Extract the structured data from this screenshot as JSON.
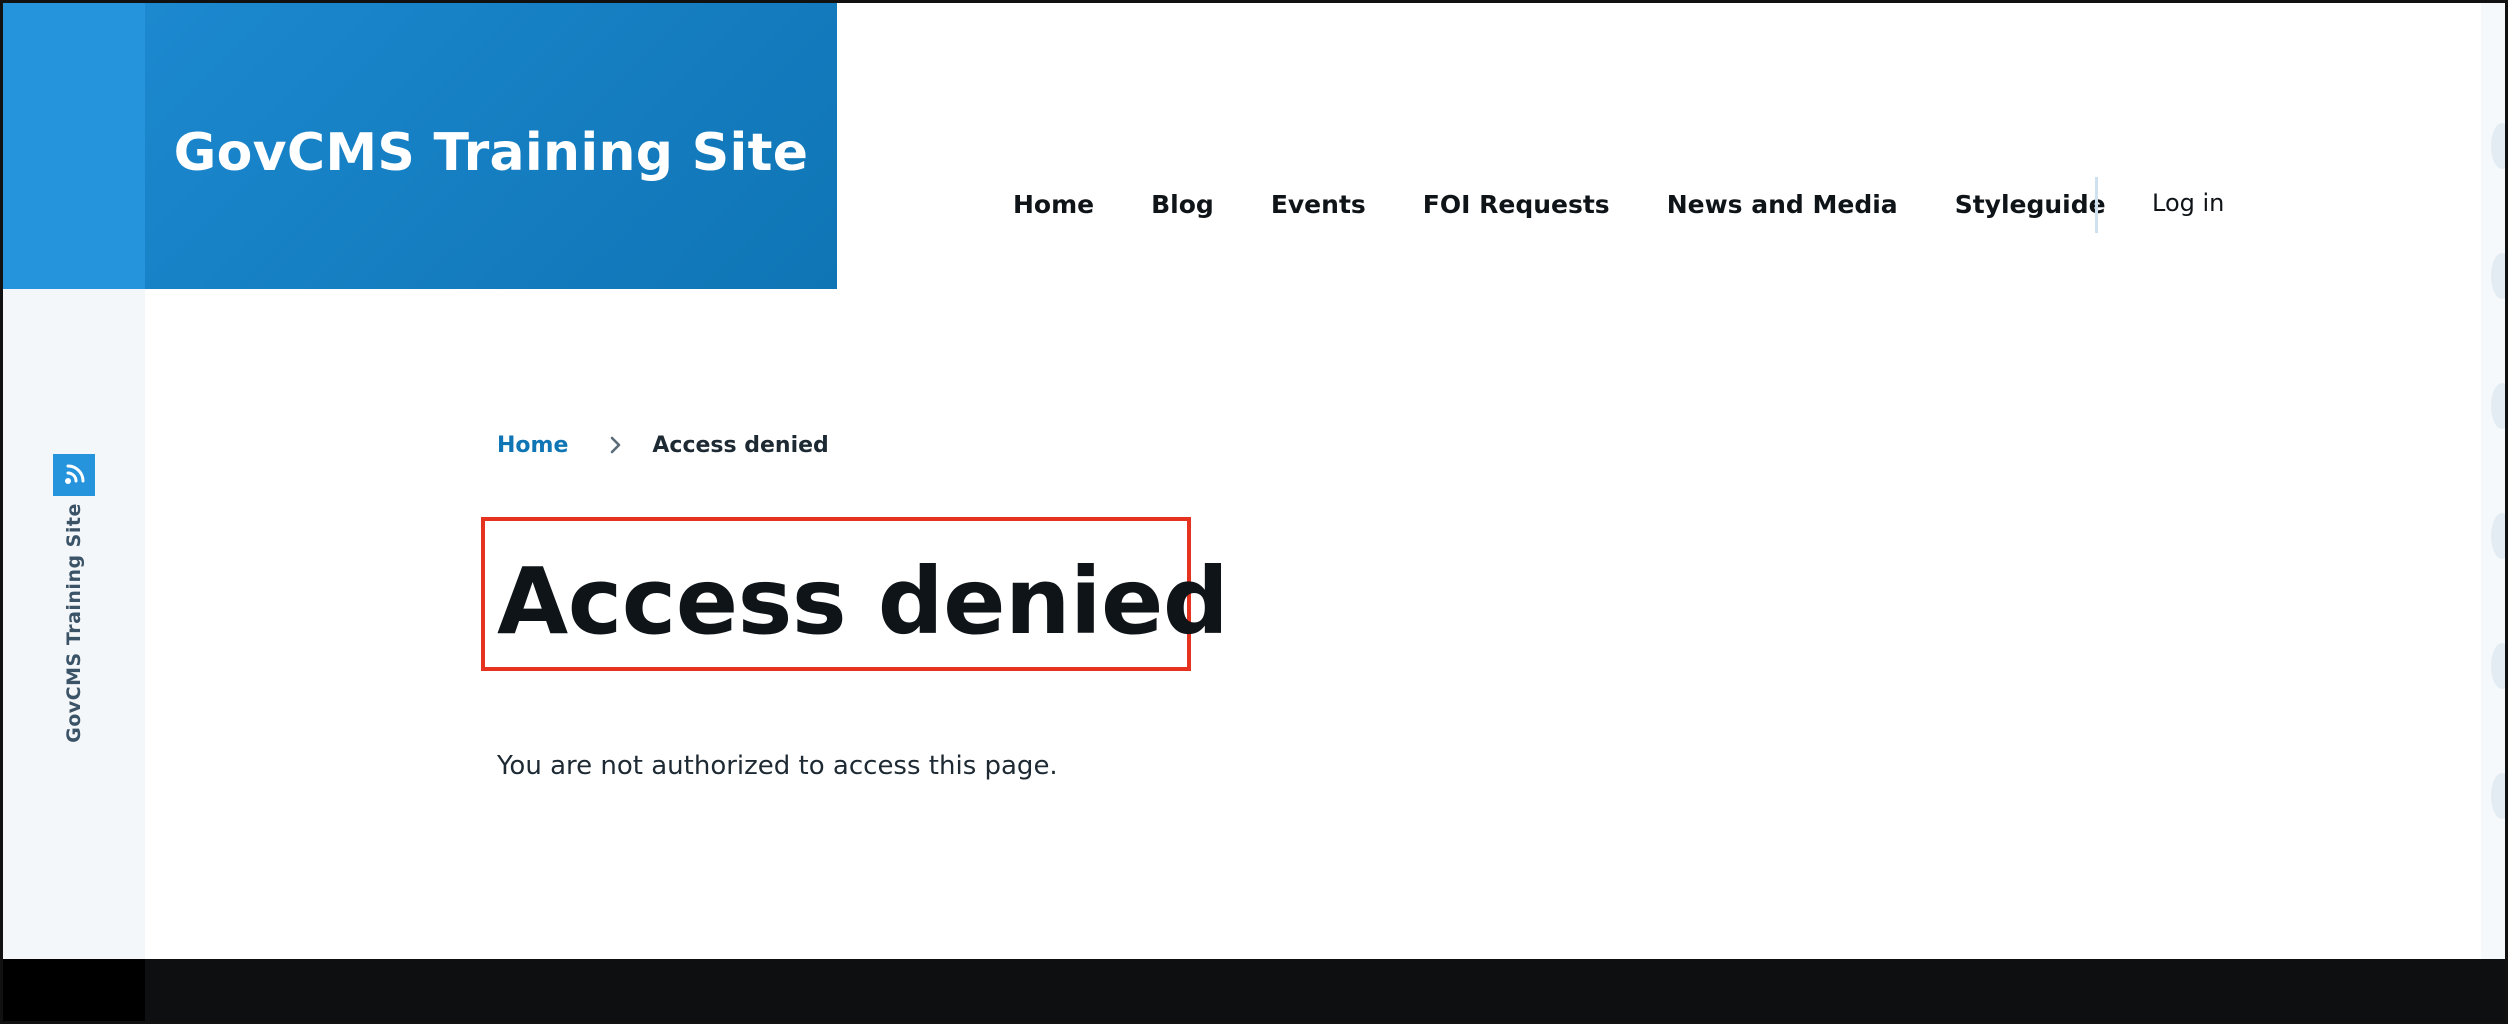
{
  "site": {
    "title": "GovCMS Training Site",
    "side_label": "GovCMS Training Site"
  },
  "nav": {
    "items": [
      {
        "label": "Home"
      },
      {
        "label": "Blog"
      },
      {
        "label": "Events"
      },
      {
        "label": "FOI Requests"
      },
      {
        "label": "News and Media"
      },
      {
        "label": "Styleguide"
      }
    ],
    "login_label": "Log in"
  },
  "breadcrumb": {
    "home_label": "Home",
    "current_label": "Access denied"
  },
  "page": {
    "title": "Access denied",
    "message": "You are not authorized to access this page."
  },
  "colors": {
    "brand_blue": "#1c88cf",
    "side_blue": "#2693dd",
    "link_blue": "#0f75b5",
    "highlight_red": "#e6331f",
    "footer": "#0e0f11"
  },
  "icons": {
    "side_logo": "wireless-signal-icon",
    "breadcrumb_separator": "chevron-right-icon"
  }
}
